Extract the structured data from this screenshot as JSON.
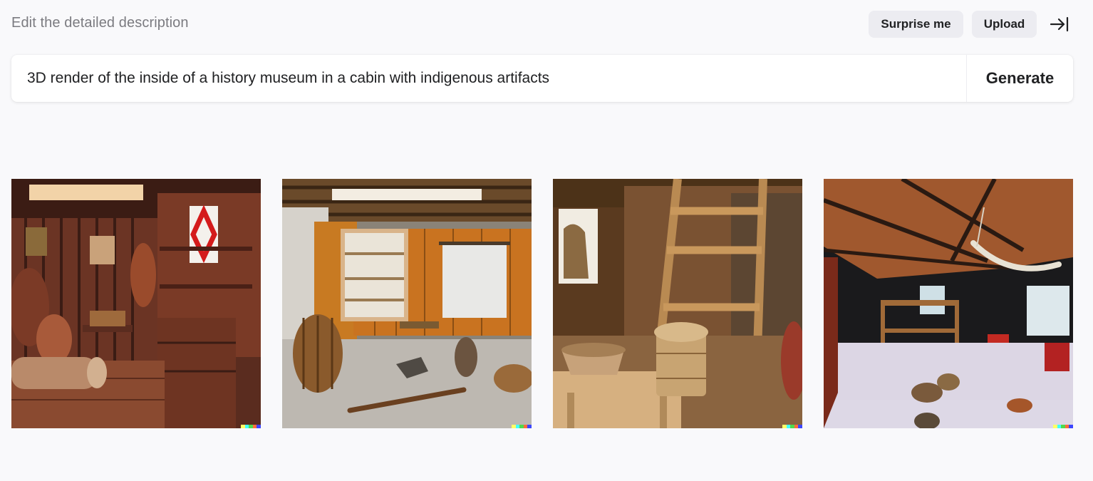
{
  "header": {
    "subtitle": "Edit the detailed description",
    "surprise_label": "Surprise me",
    "upload_label": "Upload",
    "collapse_icon": "collapse-sidebar-icon"
  },
  "prompt": {
    "text": "3D render of the inside of a history museum in a cabin with indigenous artifacts",
    "generate_label": "Generate"
  },
  "results": [
    {
      "name": "generated-image-1",
      "description_icon": "image"
    },
    {
      "name": "generated-image-2",
      "description_icon": "image"
    },
    {
      "name": "generated-image-3",
      "description_icon": "image"
    },
    {
      "name": "generated-image-4",
      "description_icon": "image"
    }
  ],
  "watermark_colors": [
    "#ffff66",
    "#42ffff",
    "#51da4c",
    "#ff6e3c",
    "#3c46ff"
  ],
  "colors": {
    "background": "#f9f9fb",
    "button_bg": "#ececf1",
    "text": "#202123",
    "muted": "#7b7b80"
  }
}
